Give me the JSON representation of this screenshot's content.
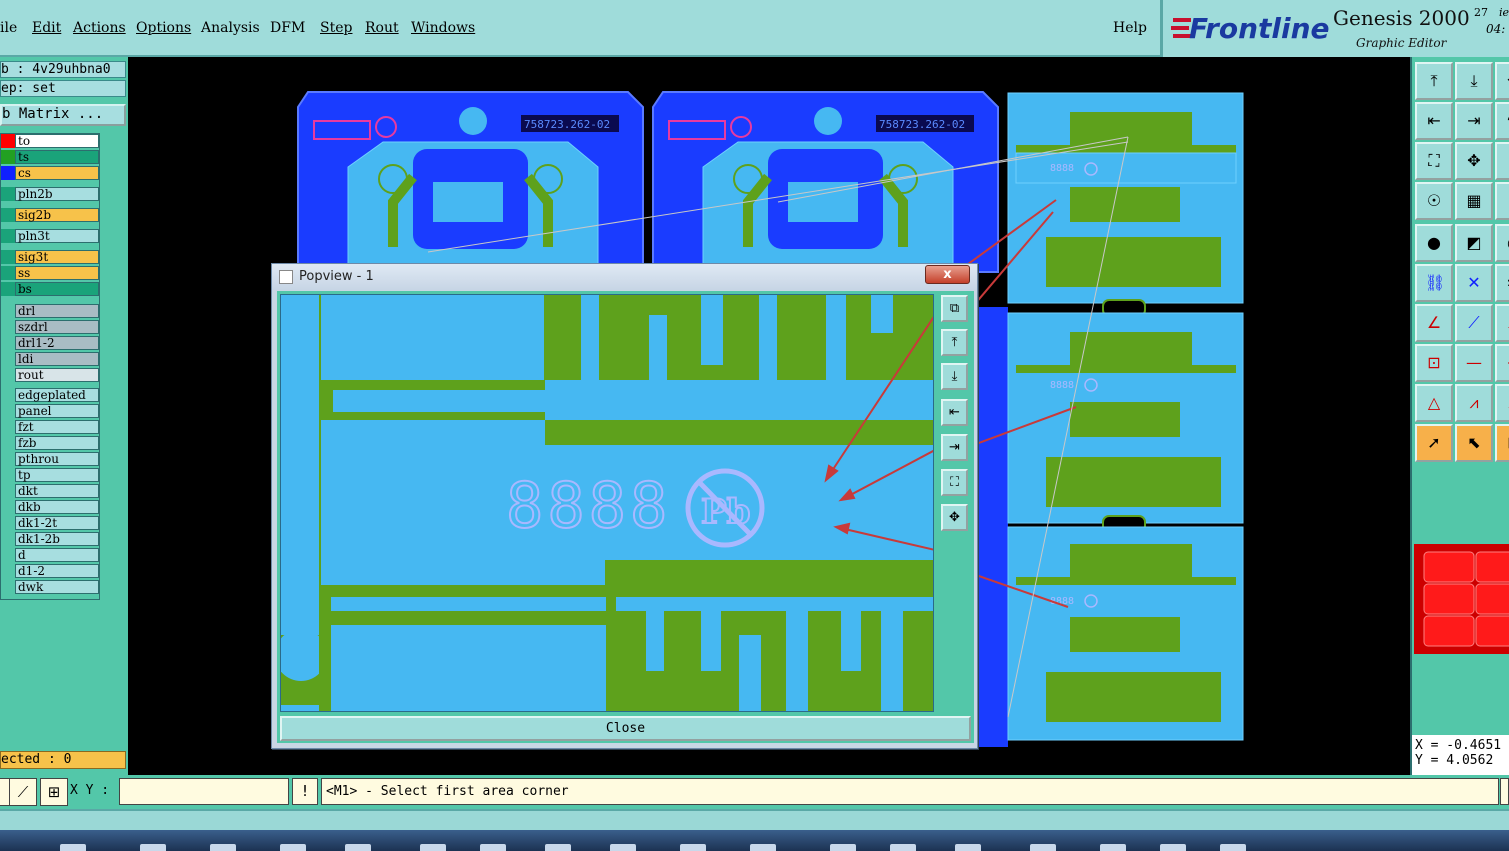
{
  "menu": {
    "items": [
      "ile",
      "Edit",
      "Actions",
      "Options",
      "Analysis",
      "DFM",
      "Step",
      "Rout",
      "Windows"
    ],
    "help": "Help"
  },
  "brand": {
    "logo": "Frontline",
    "product": "Genesis 2000",
    "subtitle": "Graphic Editor",
    "date_fragment": "27",
    "date_fragment2": "ie",
    "time_fragment": "04:"
  },
  "left": {
    "job": "b : 4v29uhbna0",
    "step": "ep: set",
    "matrix_button": "b Matrix ...",
    "layers": [
      {
        "name": "to",
        "color": "#ff0000",
        "bg": "#ffffff"
      },
      {
        "name": "ts",
        "color": "#22a022",
        "bg": "#1aa37a"
      },
      {
        "name": "cs",
        "color": "#1020ff",
        "bg": "#f7c24a"
      },
      {
        "name": "pln2b",
        "color": "#1aa37a",
        "bg": "#a7dee0"
      },
      {
        "name": "sig2b",
        "color": "#1aa37a",
        "bg": "#f7c24a"
      },
      {
        "name": "pln3t",
        "color": "#1aa37a",
        "bg": "#a7dee0"
      },
      {
        "name": "sig3t",
        "color": "#1aa37a",
        "bg": "#f7c24a"
      },
      {
        "name": "ss",
        "color": "#1aa37a",
        "bg": "#f7c24a"
      },
      {
        "name": "bs",
        "color": "#1aa37a",
        "bg": "#1aa37a"
      },
      {
        "name": "drl",
        "color": "#53c7a9",
        "bg": "#a9bcc4"
      },
      {
        "name": "szdrl",
        "color": "#53c7a9",
        "bg": "#a9bcc4"
      },
      {
        "name": "drl1-2",
        "color": "#53c7a9",
        "bg": "#a9bcc4"
      },
      {
        "name": "ldi",
        "color": "#53c7a9",
        "bg": "#a9bcc4"
      },
      {
        "name": "rout",
        "color": "#53c7a9",
        "bg": "#d8e4e8"
      },
      {
        "name": "edgeplated",
        "color": "#53c7a9",
        "bg": "#a7dee0"
      },
      {
        "name": "panel",
        "color": "#53c7a9",
        "bg": "#a7dee0"
      },
      {
        "name": "fzt",
        "color": "#53c7a9",
        "bg": "#a7dee0"
      },
      {
        "name": "fzb",
        "color": "#53c7a9",
        "bg": "#a7dee0"
      },
      {
        "name": "pthrou",
        "color": "#53c7a9",
        "bg": "#a7dee0"
      },
      {
        "name": "tp",
        "color": "#53c7a9",
        "bg": "#a7dee0"
      },
      {
        "name": "dkt",
        "color": "#53c7a9",
        "bg": "#a7dee0"
      },
      {
        "name": "dkb",
        "color": "#53c7a9",
        "bg": "#a7dee0"
      },
      {
        "name": "dk1-2t",
        "color": "#53c7a9",
        "bg": "#a7dee0"
      },
      {
        "name": "dk1-2b",
        "color": "#53c7a9",
        "bg": "#a7dee0"
      },
      {
        "name": "d",
        "color": "#53c7a9",
        "bg": "#a7dee0"
      },
      {
        "name": "d1-2",
        "color": "#53c7a9",
        "bg": "#a7dee0"
      },
      {
        "name": "dwk",
        "color": "#53c7a9",
        "bg": "#a7dee0"
      }
    ],
    "selected": "ected : 0"
  },
  "canvas": {
    "part_number": "758723.262-02",
    "digits": "8888"
  },
  "coords": {
    "x": "X = -0.4651",
    "y": "Y =  4.0562"
  },
  "status": {
    "xy_label": "X Y :",
    "xy_value": "",
    "excl": "!",
    "prompt": "<M1> - Select first area corner"
  },
  "popview": {
    "title": "Popview - 1",
    "close_x": "x",
    "close_button": "Close",
    "digits": "8888",
    "pb_label": "Pb"
  },
  "colors": {
    "board_blue": "#1a3cff",
    "copper_green": "#5ea11c",
    "substrate_cyan": "#46b8f2",
    "annotation_red": "#c83a3a",
    "panel_teal": "#53c7a9"
  }
}
